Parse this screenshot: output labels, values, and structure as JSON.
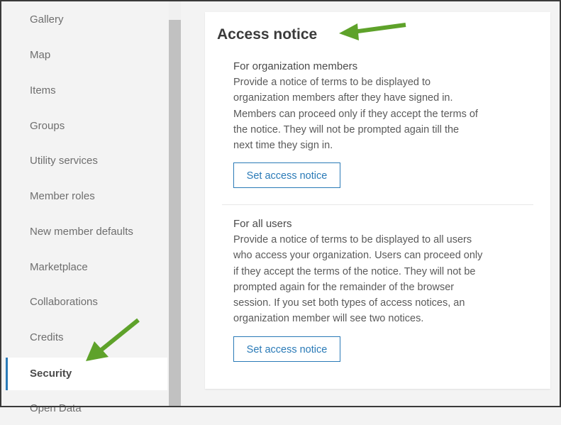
{
  "sidebar": {
    "items": [
      {
        "label": "Gallery"
      },
      {
        "label": "Map"
      },
      {
        "label": "Items"
      },
      {
        "label": "Groups"
      },
      {
        "label": "Utility services"
      },
      {
        "label": "Member roles"
      },
      {
        "label": "New member defaults"
      },
      {
        "label": "Marketplace"
      },
      {
        "label": "Collaborations"
      },
      {
        "label": "Credits"
      },
      {
        "label": "Security",
        "active": true
      },
      {
        "label": "Open Data"
      }
    ]
  },
  "main": {
    "title": "Access notice",
    "sections": [
      {
        "title": "For organization members",
        "lines": [
          "Provide a notice of terms to be displayed to",
          "organization members after they have signed in.",
          "Members can proceed only if they accept the terms of",
          "the notice. They will not be prompted again till the",
          "next time they sign in."
        ],
        "button_label": "Set access notice"
      },
      {
        "title": "For all users",
        "lines": [
          "Provide a notice of terms to be displayed to all users",
          "who access your organization. Users can proceed only",
          "if they accept the terms of the notice. They will not be",
          "prompted again for the remainder of the browser",
          "session. If you set both types of access notices, an",
          "organization member will see two notices."
        ],
        "button_label": "Set access notice"
      }
    ]
  },
  "colors": {
    "accent": "#2a7ab7",
    "annotation_arrow": "#5ea22a"
  }
}
